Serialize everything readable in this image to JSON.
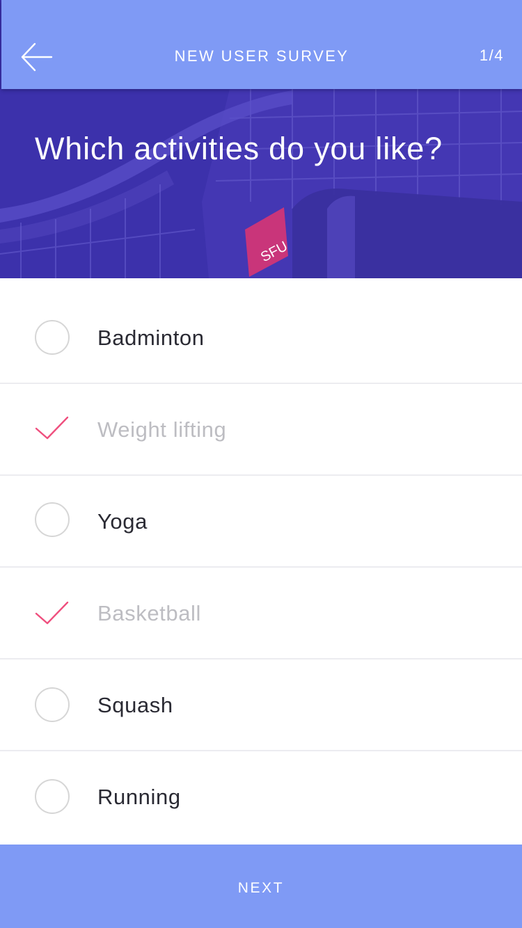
{
  "navbar": {
    "title": "NEW USER SURVEY",
    "step": "1/4",
    "back_icon": "arrow-left-icon"
  },
  "hero": {
    "question": "Which activities do you like?",
    "sign_text": "SFU"
  },
  "options": [
    {
      "label": "Badminton",
      "selected": false
    },
    {
      "label": "Weight lifting",
      "selected": true
    },
    {
      "label": "Yoga",
      "selected": false
    },
    {
      "label": "Basketball",
      "selected": true
    },
    {
      "label": "Squash",
      "selected": false
    },
    {
      "label": "Running",
      "selected": false
    }
  ],
  "footer": {
    "next_label": "NEXT"
  },
  "colors": {
    "accent": "#7f9af5",
    "check": "#ef4f7e",
    "hero_overlay": "#3a2fa8",
    "selected_text": "#bdbdc2"
  }
}
